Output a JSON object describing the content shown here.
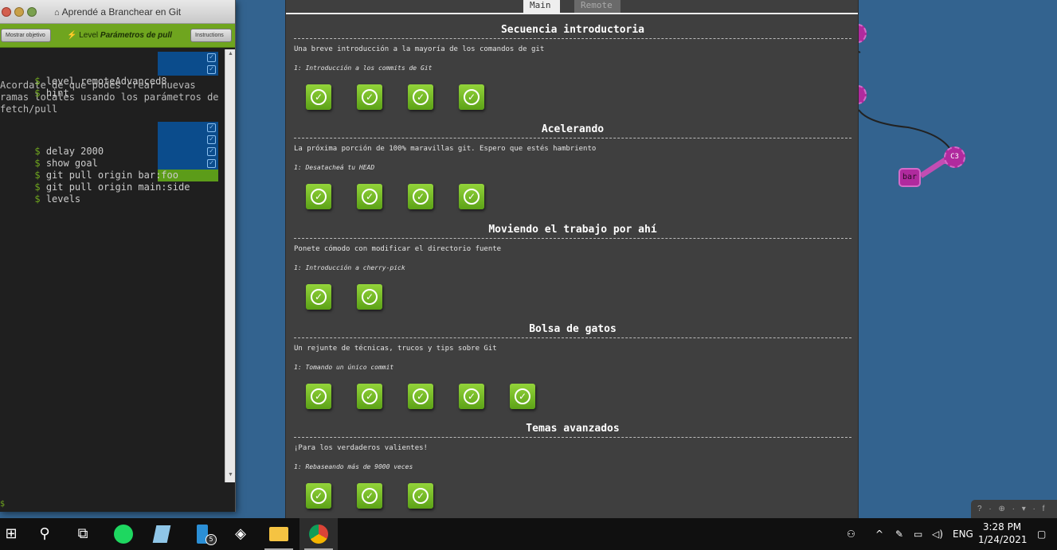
{
  "terminal": {
    "window_title": "Aprendé a Branchear en Git",
    "show_goal_button": "Mostrar objetivo",
    "level_prefix": "Level",
    "level_name": "Parámetros de pull",
    "instructions_button": "Instructions",
    "commands_top": [
      "level remoteAdvanced8",
      "hint"
    ],
    "hint_text": "Acordate de que podés crear nuevas\nramas locales usando los parámetros de\nfetch/pull",
    "commands_bottom": [
      "delay 2000",
      "show goal",
      "git pull origin bar:foo",
      "git pull origin main:side",
      "levels"
    ],
    "prompt": "$"
  },
  "graph": {
    "commit_label": "C3",
    "branch_label": "bar",
    "corner_icons": "? · ⊕ · ▾ · f"
  },
  "levels_dialog": {
    "tabs": [
      {
        "label": "Main",
        "active": true
      },
      {
        "label": "Remote",
        "active": false
      }
    ],
    "sections": [
      {
        "title": "Secuencia introductoria",
        "description": "Una breve introducción a la mayoría de los comandos de git",
        "selected": "1: Introducción a los commits de Git",
        "level_count": 4
      },
      {
        "title": "Acelerando",
        "description": "La próxima porción de 100% maravillas git. Espero que estés hambriento",
        "selected": "1: Desatacheá tu HEAD",
        "level_count": 4
      },
      {
        "title": "Moviendo el trabajo por ahí",
        "description": "Ponete cómodo con modificar el directorio fuente",
        "selected": "1: Introducción a cherry-pick",
        "level_count": 2
      },
      {
        "title": "Bolsa de gatos",
        "description": "Un rejunte de técnicas, trucos y tips sobre Git",
        "selected": "1: Tomando un único commit",
        "level_count": 5
      },
      {
        "title": "Temas avanzados",
        "description": "¡Para los verdaderos valientes!",
        "selected": "1: Rebaseando más de 9000 veces",
        "level_count": 3
      }
    ]
  },
  "taskbar": {
    "badge_count": "5",
    "language": "ENG",
    "time": "3:28 PM",
    "date": "1/24/2021",
    "icons": [
      "windows-start-icon",
      "search-icon",
      "task-view-icon",
      "spotify-icon",
      "notes-icon",
      "phone-icon",
      "unity-icon",
      "file-explorer-icon",
      "chrome-icon"
    ]
  }
}
